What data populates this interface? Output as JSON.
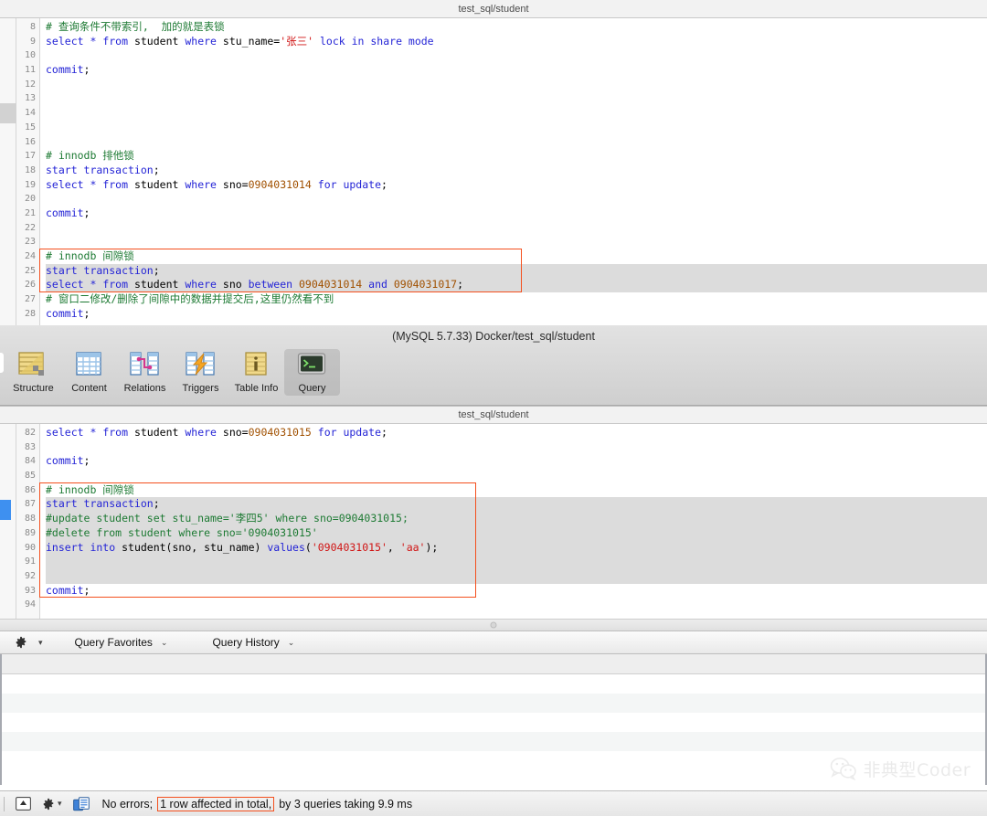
{
  "window": {
    "top_title": "test_sql/student",
    "lower_pane_title": "test_sql/student"
  },
  "toolbar": {
    "caption": "(MySQL 5.7.33) Docker/test_sql/student",
    "items": [
      {
        "label": "Structure",
        "icon": "structure-icon",
        "active": false
      },
      {
        "label": "Content",
        "icon": "content-icon",
        "active": false
      },
      {
        "label": "Relations",
        "icon": "relations-icon",
        "active": false
      },
      {
        "label": "Triggers",
        "icon": "triggers-icon",
        "active": false
      },
      {
        "label": "Table Info",
        "icon": "table-info-icon",
        "active": false
      },
      {
        "label": "Query",
        "icon": "query-icon",
        "active": true
      }
    ]
  },
  "top_editor": {
    "first_line_number": 8,
    "lines": [
      {
        "n": 8,
        "tokens": [
          {
            "t": "# 查询条件不带索引,  加的就是表锁",
            "c": "cmt"
          }
        ]
      },
      {
        "n": 9,
        "tokens": [
          {
            "t": "select ",
            "c": "k"
          },
          {
            "t": "* ",
            "c": "k"
          },
          {
            "t": "from ",
            "c": "k"
          },
          {
            "t": "student ",
            "c": "id"
          },
          {
            "t": "where ",
            "c": "k"
          },
          {
            "t": "stu_name=",
            "c": "id"
          },
          {
            "t": "'张三'",
            "c": "str"
          },
          {
            "t": " lock in share mode",
            "c": "k"
          }
        ]
      },
      {
        "n": 10,
        "tokens": []
      },
      {
        "n": 11,
        "tokens": [
          {
            "t": "commit",
            "c": "k"
          },
          {
            "t": ";",
            "c": "id"
          }
        ]
      },
      {
        "n": 12,
        "tokens": []
      },
      {
        "n": 13,
        "tokens": []
      },
      {
        "n": 14,
        "tokens": []
      },
      {
        "n": 15,
        "tokens": []
      },
      {
        "n": 16,
        "tokens": []
      },
      {
        "n": 17,
        "tokens": [
          {
            "t": "# innodb 排他锁",
            "c": "cmt"
          }
        ]
      },
      {
        "n": 18,
        "tokens": [
          {
            "t": "start transaction",
            "c": "k"
          },
          {
            "t": ";",
            "c": "id"
          }
        ]
      },
      {
        "n": 19,
        "tokens": [
          {
            "t": "select ",
            "c": "k"
          },
          {
            "t": "* ",
            "c": "k"
          },
          {
            "t": "from ",
            "c": "k"
          },
          {
            "t": "student ",
            "c": "id"
          },
          {
            "t": "where ",
            "c": "k"
          },
          {
            "t": "sno=",
            "c": "id"
          },
          {
            "t": "0904031014",
            "c": "num"
          },
          {
            "t": " for update",
            "c": "k"
          },
          {
            "t": ";",
            "c": "id"
          }
        ]
      },
      {
        "n": 20,
        "tokens": []
      },
      {
        "n": 21,
        "tokens": [
          {
            "t": "commit",
            "c": "k"
          },
          {
            "t": ";",
            "c": "id"
          }
        ]
      },
      {
        "n": 22,
        "tokens": []
      },
      {
        "n": 23,
        "tokens": []
      },
      {
        "n": 24,
        "tokens": [
          {
            "t": "# innodb 间隙锁",
            "c": "cmt"
          }
        ],
        "sel": false
      },
      {
        "n": 25,
        "tokens": [
          {
            "t": "start transaction",
            "c": "k"
          },
          {
            "t": ";",
            "c": "id"
          }
        ],
        "sel": true
      },
      {
        "n": 26,
        "tokens": [
          {
            "t": "select ",
            "c": "k"
          },
          {
            "t": "* ",
            "c": "k"
          },
          {
            "t": "from ",
            "c": "k"
          },
          {
            "t": "student ",
            "c": "id"
          },
          {
            "t": "where ",
            "c": "k"
          },
          {
            "t": "sno ",
            "c": "id"
          },
          {
            "t": "between ",
            "c": "k"
          },
          {
            "t": "0904031014 ",
            "c": "num"
          },
          {
            "t": "and ",
            "c": "k"
          },
          {
            "t": "0904031017",
            "c": "num"
          },
          {
            "t": ";",
            "c": "id"
          }
        ],
        "sel": true
      },
      {
        "n": 27,
        "tokens": [
          {
            "t": "# 窗口二修改/删除了间隙中的数据并提交后,这里仍然看不到",
            "c": "cmt"
          }
        ]
      },
      {
        "n": 28,
        "tokens": [
          {
            "t": "commit",
            "c": "k"
          },
          {
            "t": ";",
            "c": "id"
          }
        ]
      }
    ],
    "highlight_box": {
      "from_line": 24,
      "to_line": 26
    }
  },
  "bottom_editor": {
    "first_line_number": 82,
    "lines": [
      {
        "n": 82,
        "tokens": [
          {
            "t": "select ",
            "c": "k"
          },
          {
            "t": "* ",
            "c": "k"
          },
          {
            "t": "from ",
            "c": "k"
          },
          {
            "t": "student ",
            "c": "id"
          },
          {
            "t": "where ",
            "c": "k"
          },
          {
            "t": "sno=",
            "c": "id"
          },
          {
            "t": "0904031015",
            "c": "num"
          },
          {
            "t": " for update",
            "c": "k"
          },
          {
            "t": ";",
            "c": "id"
          }
        ]
      },
      {
        "n": 83,
        "tokens": []
      },
      {
        "n": 84,
        "tokens": [
          {
            "t": "commit",
            "c": "k"
          },
          {
            "t": ";",
            "c": "id"
          }
        ]
      },
      {
        "n": 85,
        "tokens": []
      },
      {
        "n": 86,
        "tokens": [
          {
            "t": "# innodb 间隙锁",
            "c": "cmt"
          }
        ],
        "sel": false
      },
      {
        "n": 87,
        "tokens": [
          {
            "t": "start transaction",
            "c": "k"
          },
          {
            "t": ";",
            "c": "id"
          }
        ],
        "sel": true
      },
      {
        "n": 88,
        "tokens": [
          {
            "t": "#update student set stu_name='李四5' where sno=0904031015;",
            "c": "cmt"
          }
        ],
        "sel": true
      },
      {
        "n": 89,
        "tokens": [
          {
            "t": "#delete from student where sno='0904031015'",
            "c": "cmt"
          }
        ],
        "sel": true
      },
      {
        "n": 90,
        "tokens": [
          {
            "t": "insert into ",
            "c": "k"
          },
          {
            "t": "student(sno, stu_name) ",
            "c": "id"
          },
          {
            "t": "values",
            "c": "k"
          },
          {
            "t": "(",
            "c": "id"
          },
          {
            "t": "'0904031015'",
            "c": "str"
          },
          {
            "t": ", ",
            "c": "id"
          },
          {
            "t": "'aa'",
            "c": "str"
          },
          {
            "t": ");",
            "c": "id"
          }
        ],
        "sel": true
      },
      {
        "n": 91,
        "tokens": [],
        "sel": true
      },
      {
        "n": 92,
        "tokens": [],
        "sel": true
      },
      {
        "n": 93,
        "tokens": [
          {
            "t": "commit",
            "c": "k"
          },
          {
            "t": ";",
            "c": "id"
          }
        ]
      },
      {
        "n": 94,
        "tokens": []
      }
    ],
    "highlight_box": {
      "from_line": 86,
      "to_line": 93
    }
  },
  "query_bar": {
    "gear_label": "",
    "favorites_label": "Query Favorites",
    "history_label": "Query History",
    "caret": "⌄"
  },
  "results": {
    "row_count": 5
  },
  "watermark": {
    "text": "非典型Coder",
    "icon": "wechat-icon"
  },
  "status_bar": {
    "prefix": "No errors;",
    "highlight": "1 row affected in total,",
    "suffix": "by 3 queries taking 9.9 ms",
    "icons": [
      "expand-icon",
      "gear-icon",
      "table-doc-icon"
    ]
  },
  "colors": {
    "accent_red": "#f4501e",
    "keyword_blue": "#2424d6",
    "comment_green": "#1d7a33",
    "number_brown": "#a05000",
    "string_red": "#d01414",
    "selection_gray": "#dcdcdc",
    "marker_blue": "#3e90f0"
  }
}
